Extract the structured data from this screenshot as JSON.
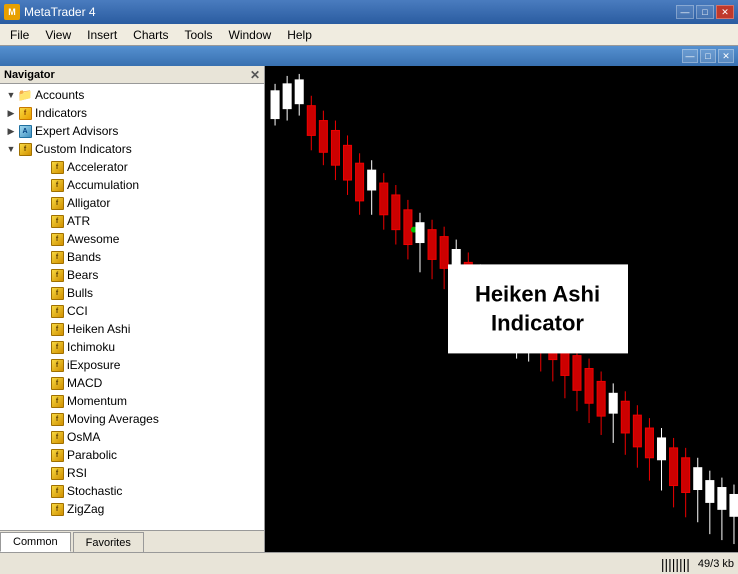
{
  "titleBar": {
    "appName": "MetaTrader 4",
    "controls": {
      "minimize": "—",
      "maximize": "□",
      "close": "✕"
    }
  },
  "menuBar": {
    "items": [
      "File",
      "View",
      "Insert",
      "Charts",
      "Tools",
      "Window",
      "Help"
    ]
  },
  "subTitleBar": {
    "title": "",
    "controls": {
      "minimize": "—",
      "maximize": "□",
      "close": "✕"
    }
  },
  "navigator": {
    "title": "Navigator",
    "tree": [
      {
        "id": "accounts",
        "label": "Accounts",
        "level": 1,
        "expanded": true,
        "type": "folder"
      },
      {
        "id": "indicators",
        "label": "Indicators",
        "level": 1,
        "expanded": false,
        "type": "indicator"
      },
      {
        "id": "expert-advisors",
        "label": "Expert Advisors",
        "level": 1,
        "expanded": false,
        "type": "ea"
      },
      {
        "id": "custom-indicators",
        "label": "Custom Indicators",
        "level": 1,
        "expanded": true,
        "type": "ci"
      },
      {
        "id": "accelerator",
        "label": "Accelerator",
        "level": 2,
        "type": "ci"
      },
      {
        "id": "accumulation",
        "label": "Accumulation",
        "level": 2,
        "type": "ci"
      },
      {
        "id": "alligator",
        "label": "Alligator",
        "level": 2,
        "type": "ci"
      },
      {
        "id": "atr",
        "label": "ATR",
        "level": 2,
        "type": "ci"
      },
      {
        "id": "awesome",
        "label": "Awesome",
        "level": 2,
        "type": "ci"
      },
      {
        "id": "bands",
        "label": "Bands",
        "level": 2,
        "type": "ci"
      },
      {
        "id": "bears",
        "label": "Bears",
        "level": 2,
        "type": "ci"
      },
      {
        "id": "bulls",
        "label": "Bulls",
        "level": 2,
        "type": "ci"
      },
      {
        "id": "cci",
        "label": "CCI",
        "level": 2,
        "type": "ci"
      },
      {
        "id": "heiken-ashi",
        "label": "Heiken Ashi",
        "level": 2,
        "type": "ci"
      },
      {
        "id": "ichimoku",
        "label": "Ichimoku",
        "level": 2,
        "type": "ci"
      },
      {
        "id": "iexposure",
        "label": "iExposure",
        "level": 2,
        "type": "ci"
      },
      {
        "id": "macd",
        "label": "MACD",
        "level": 2,
        "type": "ci"
      },
      {
        "id": "momentum",
        "label": "Momentum",
        "level": 2,
        "type": "ci"
      },
      {
        "id": "moving-averages",
        "label": "Moving Averages",
        "level": 2,
        "type": "ci"
      },
      {
        "id": "osma",
        "label": "OsMA",
        "level": 2,
        "type": "ci"
      },
      {
        "id": "parabolic",
        "label": "Parabolic",
        "level": 2,
        "type": "ci"
      },
      {
        "id": "rsi",
        "label": "RSI",
        "level": 2,
        "type": "ci"
      },
      {
        "id": "stochastic",
        "label": "Stochastic",
        "level": 2,
        "type": "ci"
      },
      {
        "id": "zigzag",
        "label": "ZigZag",
        "level": 2,
        "type": "ci"
      }
    ],
    "tabs": [
      "Common",
      "Favorites"
    ]
  },
  "chart": {
    "label": {
      "line1": "Heiken Ashi",
      "line2": "Indicator"
    }
  },
  "statusBar": {
    "statusIconLabel": "||||||||",
    "sizeLabel": "49/3 kb"
  }
}
